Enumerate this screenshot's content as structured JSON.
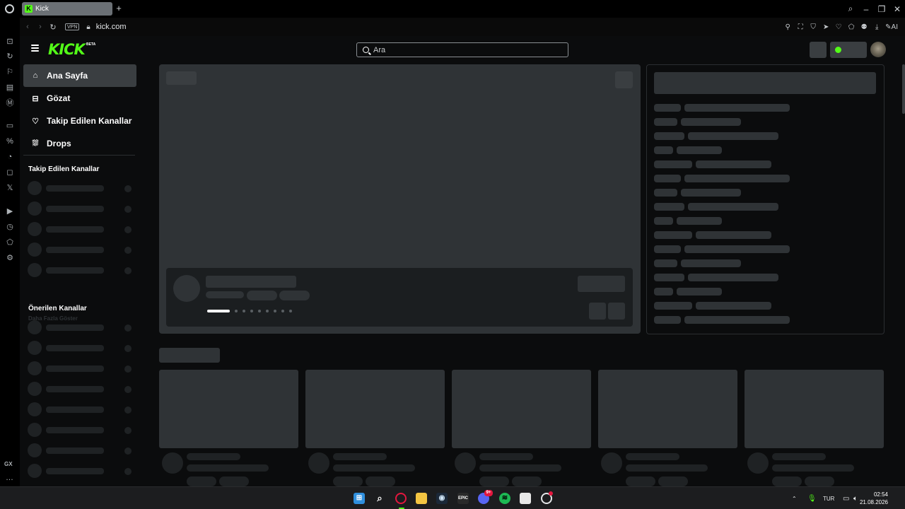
{
  "browser": {
    "tab_title": "Kick",
    "tab_favicon": "K",
    "new_tab": "+",
    "url": "kick.com",
    "vpn_badge": "VPN",
    "ai_label": "AI",
    "sidebar_badge": "GX",
    "sidebar_more": "…"
  },
  "site": {
    "logo": "KICK",
    "logo_badge": "BETA",
    "search_placeholder": "Ara",
    "accent": "#53fc18"
  },
  "sidebar": {
    "items": [
      {
        "label": "Ana Sayfa",
        "icon": "home-icon"
      },
      {
        "label": "Gözat",
        "icon": "browse-icon"
      },
      {
        "label": "Takip Edilen Kanallar",
        "icon": "heart-icon"
      },
      {
        "label": "Drops",
        "icon": "drops-icon"
      }
    ],
    "following_title": "Takip Edilen Kanallar",
    "show_more": "Daha Fazla Göster",
    "recommended_title": "Önerilen Kanallar"
  },
  "taskbar": {
    "discord_badge": "9+",
    "language": "TUR",
    "time": "02:54",
    "date": "21.08.2026"
  }
}
